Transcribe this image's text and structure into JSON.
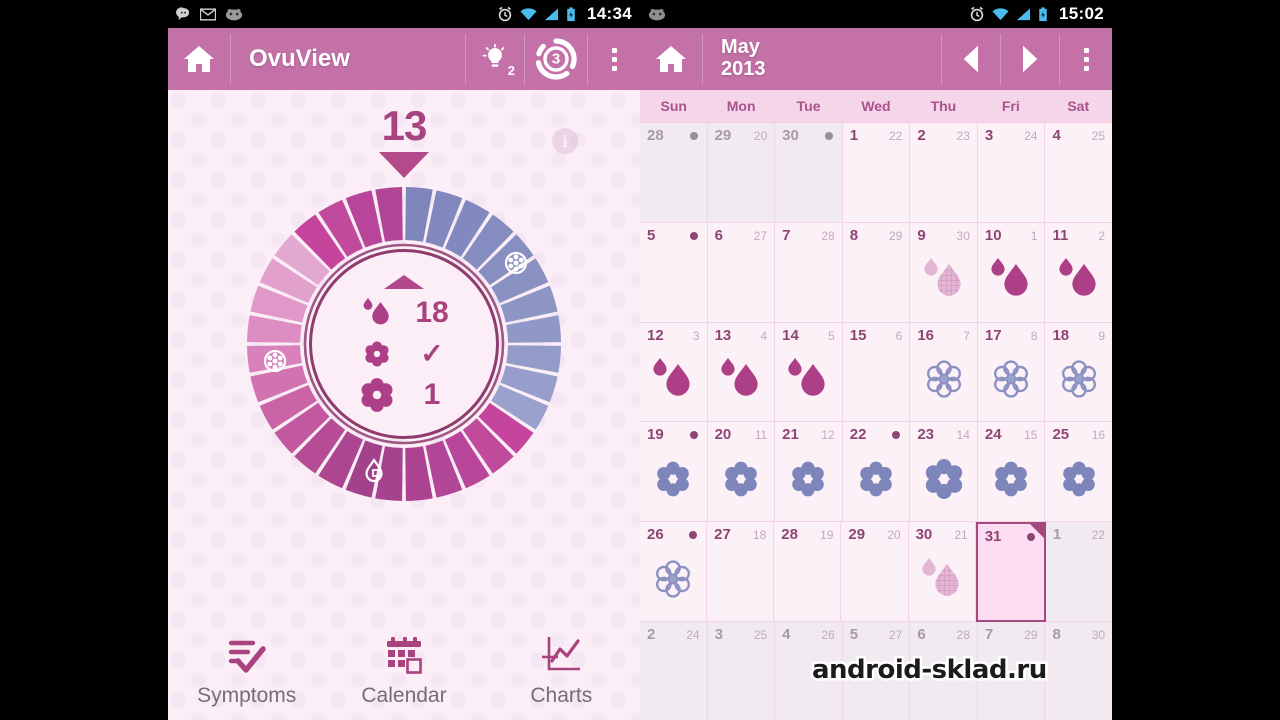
{
  "left": {
    "statusbar": {
      "icons": [
        "chat-bubble-icon",
        "gmail-icon",
        "cyanogen-icon"
      ],
      "right_icons": [
        "alarm-icon",
        "wifi-icon",
        "signal-icon",
        "battery-icon"
      ],
      "clock": "14:34"
    },
    "actionbar": {
      "home_label": "home-icon",
      "title": "OvuView",
      "tip_badge": "2",
      "cycle_badge": "3",
      "overflow_label": "overflow-menu"
    },
    "wheel": {
      "day_number": "13",
      "info_label": "i",
      "rows": [
        {
          "icon": "droplet-icon",
          "value": "18"
        },
        {
          "icon": "small-flower-icon",
          "value": "✓"
        },
        {
          "icon": "large-flower-icon",
          "value": "1"
        }
      ]
    },
    "bottomnav": [
      {
        "icon": "symptoms-checklist-icon",
        "label": "Symptoms"
      },
      {
        "icon": "calendar-icon",
        "label": "Calendar"
      },
      {
        "icon": "charts-icon",
        "label": "Charts"
      }
    ]
  },
  "right": {
    "statusbar": {
      "icons": [
        "cyanogen-icon"
      ],
      "right_icons": [
        "alarm-icon",
        "wifi-icon",
        "signal-icon",
        "battery-icon"
      ],
      "clock": "15:02"
    },
    "actionbar": {
      "home_label": "home-icon",
      "month": "May",
      "year": "2013",
      "prev_label": "previous-month",
      "next_label": "next-month",
      "overflow_label": "overflow-menu"
    },
    "weekdays": [
      "Sun",
      "Mon",
      "Tue",
      "Wed",
      "Thu",
      "Fri",
      "Sat"
    ],
    "weeks": [
      [
        {
          "day": "28",
          "sub": "",
          "dot": true,
          "out": true,
          "sym": "none"
        },
        {
          "day": "29",
          "sub": "20",
          "dot": false,
          "out": true,
          "sym": "none"
        },
        {
          "day": "30",
          "sub": "",
          "dot": true,
          "out": true,
          "sym": "none"
        },
        {
          "day": "1",
          "sub": "22",
          "dot": false,
          "out": false,
          "sym": "none"
        },
        {
          "day": "2",
          "sub": "23",
          "dot": false,
          "out": false,
          "sym": "none"
        },
        {
          "day": "3",
          "sub": "24",
          "dot": false,
          "out": false,
          "sym": "none"
        },
        {
          "day": "4",
          "sub": "25",
          "dot": false,
          "out": false,
          "sym": "none"
        }
      ],
      [
        {
          "day": "5",
          "sub": "",
          "dot": true,
          "out": false,
          "sym": "none"
        },
        {
          "day": "6",
          "sub": "27",
          "dot": false,
          "out": false,
          "sym": "none"
        },
        {
          "day": "7",
          "sub": "28",
          "dot": false,
          "out": false,
          "sym": "none"
        },
        {
          "day": "8",
          "sub": "29",
          "dot": false,
          "out": false,
          "sym": "none"
        },
        {
          "day": "9",
          "sub": "30",
          "dot": false,
          "out": false,
          "sym": "drops-pale"
        },
        {
          "day": "10",
          "sub": "1",
          "dot": false,
          "out": false,
          "sym": "drops"
        },
        {
          "day": "11",
          "sub": "2",
          "dot": false,
          "out": false,
          "sym": "drops"
        }
      ],
      [
        {
          "day": "12",
          "sub": "3",
          "dot": false,
          "out": false,
          "sym": "drops"
        },
        {
          "day": "13",
          "sub": "4",
          "dot": false,
          "out": false,
          "sym": "drops"
        },
        {
          "day": "14",
          "sub": "5",
          "dot": false,
          "out": false,
          "sym": "drops"
        },
        {
          "day": "15",
          "sub": "6",
          "dot": false,
          "out": false,
          "sym": "none"
        },
        {
          "day": "16",
          "sub": "7",
          "dot": false,
          "out": false,
          "sym": "flower-outline"
        },
        {
          "day": "17",
          "sub": "8",
          "dot": false,
          "out": false,
          "sym": "flower-outline"
        },
        {
          "day": "18",
          "sub": "9",
          "dot": false,
          "out": false,
          "sym": "flower-outline"
        }
      ],
      [
        {
          "day": "19",
          "sub": "",
          "dot": true,
          "out": false,
          "sym": "flower-solid"
        },
        {
          "day": "20",
          "sub": "11",
          "dot": false,
          "out": false,
          "sym": "flower-solid"
        },
        {
          "day": "21",
          "sub": "12",
          "dot": false,
          "out": false,
          "sym": "flower-solid"
        },
        {
          "day": "22",
          "sub": "",
          "dot": true,
          "out": false,
          "sym": "flower-solid"
        },
        {
          "day": "23",
          "sub": "14",
          "dot": false,
          "out": false,
          "sym": "flower-big"
        },
        {
          "day": "24",
          "sub": "15",
          "dot": false,
          "out": false,
          "sym": "flower-solid"
        },
        {
          "day": "25",
          "sub": "16",
          "dot": false,
          "out": false,
          "sym": "flower-solid"
        }
      ],
      [
        {
          "day": "26",
          "sub": "",
          "dot": true,
          "out": false,
          "sym": "flower-outline"
        },
        {
          "day": "27",
          "sub": "18",
          "dot": false,
          "out": false,
          "sym": "none"
        },
        {
          "day": "28",
          "sub": "19",
          "dot": false,
          "out": false,
          "sym": "none"
        },
        {
          "day": "29",
          "sub": "20",
          "dot": false,
          "out": false,
          "sym": "none"
        },
        {
          "day": "30",
          "sub": "21",
          "dot": false,
          "out": false,
          "sym": "drops-pale"
        },
        {
          "day": "31",
          "sub": "",
          "dot": true,
          "out": false,
          "sym": "none",
          "selected": true
        },
        {
          "day": "1",
          "sub": "22",
          "dot": false,
          "out": true,
          "sym": "none"
        }
      ],
      [
        {
          "day": "2",
          "sub": "24",
          "dot": false,
          "out": true,
          "sym": "none"
        },
        {
          "day": "3",
          "sub": "25",
          "dot": false,
          "out": true,
          "sym": "none"
        },
        {
          "day": "4",
          "sub": "26",
          "dot": false,
          "out": true,
          "sym": "none"
        },
        {
          "day": "5",
          "sub": "27",
          "dot": false,
          "out": true,
          "sym": "none"
        },
        {
          "day": "6",
          "sub": "28",
          "dot": false,
          "out": true,
          "sym": "none"
        },
        {
          "day": "7",
          "sub": "29",
          "dot": false,
          "out": true,
          "sym": "none"
        },
        {
          "day": "8",
          "sub": "30",
          "dot": false,
          "out": true,
          "sym": "none"
        }
      ]
    ]
  },
  "watermark": "android-sklad.ru",
  "colors": {
    "accent": "#c471a8",
    "deep_pink": "#a9437f",
    "fertile_blue": "#8189bd",
    "period_magenta": "#b0459a",
    "page_bg": "#fbeef6"
  }
}
